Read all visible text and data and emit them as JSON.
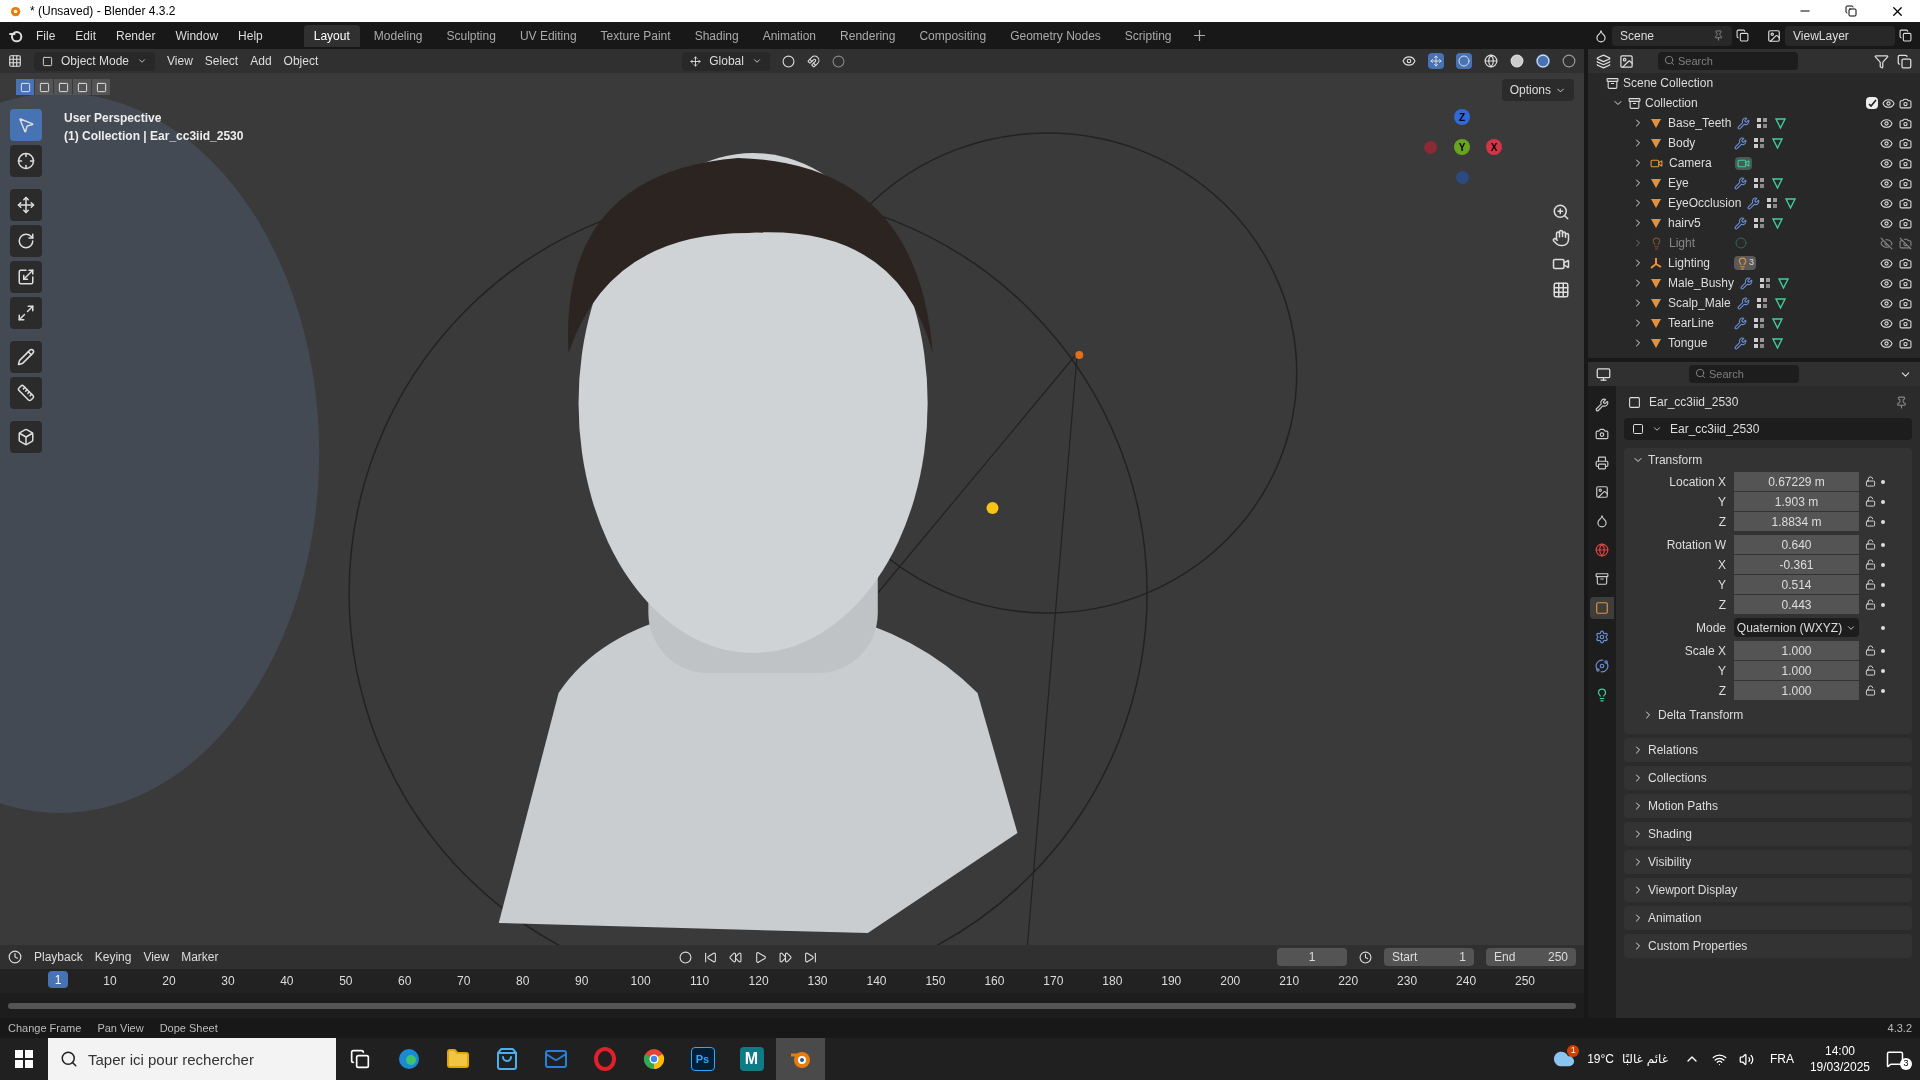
{
  "window": {
    "title": "* (Unsaved) - Blender 4.3.2"
  },
  "menu": [
    "File",
    "Edit",
    "Render",
    "Window",
    "Help"
  ],
  "workspaces": [
    {
      "label": "Layout",
      "selected": true
    },
    {
      "label": "Modeling",
      "selected": false
    },
    {
      "label": "Sculpting",
      "selected": false
    },
    {
      "label": "UV Editing",
      "selected": false
    },
    {
      "label": "Texture Paint",
      "selected": false
    },
    {
      "label": "Shading",
      "selected": false
    },
    {
      "label": "Animation",
      "selected": false
    },
    {
      "label": "Rendering",
      "selected": false
    },
    {
      "label": "Compositing",
      "selected": false
    },
    {
      "label": "Geometry Nodes",
      "selected": false
    },
    {
      "label": "Scripting",
      "selected": false
    }
  ],
  "scene": "Scene",
  "view_layer": "ViewLayer",
  "viewport_header": {
    "mode": "Object Mode",
    "menus": [
      "View",
      "Select",
      "Add",
      "Object"
    ],
    "orientation": "Global",
    "options": "Options"
  },
  "viewport": {
    "overlay": [
      "User Perspective",
      "(1) Collection | Ear_cc3iid_2530"
    ],
    "picture": {
      "kind": "picture"
    },
    "axes": [
      {
        "label": "Z",
        "color": "#2f6ad8"
      },
      {
        "label": "X",
        "color": "#d4334a"
      },
      {
        "label": "Y",
        "color": "#6aa31f"
      }
    ]
  },
  "outliner": {
    "search_placeholder": "Search",
    "root": "Scene Collection",
    "collection": {
      "name": "Collection",
      "expanded": true,
      "checked": true,
      "children": [
        {
          "name": "Base_Teeth",
          "kind": "mesh",
          "visible": true
        },
        {
          "name": "Body",
          "kind": "mesh",
          "visible": true
        },
        {
          "name": "Camera",
          "kind": "camera",
          "visible": true
        },
        {
          "name": "Eye",
          "kind": "mesh",
          "visible": true
        },
        {
          "name": "EyeOcclusion",
          "kind": "mesh",
          "visible": true
        },
        {
          "name": "hairv5",
          "kind": "mesh",
          "visible": true
        },
        {
          "name": "Light",
          "kind": "light",
          "visible": false
        },
        {
          "name": "Lighting",
          "kind": "empty",
          "visible": true,
          "badge": "3"
        },
        {
          "name": "Male_Bushy",
          "kind": "mesh",
          "visible": true
        },
        {
          "name": "Scalp_Male",
          "kind": "mesh",
          "visible": true
        },
        {
          "name": "TearLine",
          "kind": "mesh",
          "visible": true
        },
        {
          "name": "Tongue",
          "kind": "mesh",
          "visible": true
        }
      ]
    }
  },
  "properties": {
    "search_placeholder": "Search",
    "tabs": [
      {
        "kind": "tool",
        "selected": false
      },
      {
        "kind": "render",
        "selected": false
      },
      {
        "kind": "output",
        "selected": false
      },
      {
        "kind": "view_layer",
        "selected": false
      },
      {
        "kind": "scene",
        "selected": false
      },
      {
        "kind": "world",
        "selected": false
      },
      {
        "kind": "collection",
        "selected": false
      },
      {
        "kind": "object",
        "selected": true
      },
      {
        "kind": "modifiers",
        "selected": false
      },
      {
        "kind": "physics",
        "selected": false
      },
      {
        "kind": "data",
        "selected": false
      }
    ],
    "object_name": "Ear_cc3iid_2530",
    "data_name": "Ear_cc3iid_2530",
    "transform": {
      "title": "Transform",
      "expanded": true,
      "groups": [
        [
          {
            "label": "Location X",
            "value": "0.67229 m",
            "locked": false
          },
          {
            "label": "Y",
            "value": "1.903 m",
            "locked": false
          },
          {
            "label": "Z",
            "value": "1.8834 m",
            "locked": false
          }
        ],
        [
          {
            "label": "Rotation W",
            "value": "0.640",
            "locked": false
          },
          {
            "label": "X",
            "value": "-0.361",
            "locked": false
          },
          {
            "label": "Y",
            "value": "0.514",
            "locked": false
          },
          {
            "label": "Z",
            "value": "0.443",
            "locked": false
          }
        ],
        [
          {
            "label": "Mode",
            "value": "Quaternion (WXYZ)",
            "kind": "dropdown"
          }
        ],
        [
          {
            "label": "Scale X",
            "value": "1.000",
            "locked": false
          },
          {
            "label": "Y",
            "value": "1.000",
            "locked": false
          },
          {
            "label": "Z",
            "value": "1.000",
            "locked": false
          }
        ]
      ],
      "subpanel": {
        "title": "Delta Transform",
        "expanded": false
      }
    },
    "panels": [
      {
        "title": "Relations",
        "expanded": false
      },
      {
        "title": "Collections",
        "expanded": false
      },
      {
        "title": "Motion Paths",
        "expanded": false
      },
      {
        "title": "Shading",
        "expanded": false
      },
      {
        "title": "Visibility",
        "expanded": false
      },
      {
        "title": "Viewport Display",
        "expanded": false
      },
      {
        "title": "Animation",
        "expanded": false
      },
      {
        "title": "Custom Properties",
        "expanded": false
      }
    ]
  },
  "timeline": {
    "menus": [
      "Playback",
      "Keying",
      "View",
      "Marker"
    ],
    "current_frame": "1",
    "start_label": "Start",
    "start": "1",
    "end_label": "End",
    "end": "250",
    "marker": "1",
    "ticks": [
      "10",
      "20",
      "30",
      "40",
      "50",
      "60",
      "70",
      "80",
      "90",
      "100",
      "110",
      "120",
      "130",
      "140",
      "150",
      "160",
      "170",
      "180",
      "190",
      "200",
      "210",
      "220",
      "230",
      "240",
      "250"
    ]
  },
  "status_bar": {
    "hints": [
      "Change Frame",
      "Pan View",
      "Dope Sheet"
    ],
    "version": "4.3.2"
  },
  "taskbar": {
    "search_placeholder": "Taper ici pour rechercher",
    "apps": [
      {
        "kind": "edge",
        "selected": false
      },
      {
        "kind": "explorer",
        "selected": false
      },
      {
        "kind": "store",
        "selected": false
      },
      {
        "kind": "outlook",
        "selected": false
      },
      {
        "kind": "opera",
        "selected": false
      },
      {
        "kind": "chrome",
        "selected": false
      },
      {
        "kind": "photoshop",
        "label": "Ps",
        "selected": false
      },
      {
        "kind": "app",
        "label": "M",
        "selected": false
      },
      {
        "kind": "blender",
        "selected": true
      }
    ],
    "weather_badge": "1",
    "temperature": "19°C",
    "weather": "غائم غالبًا",
    "language": "FRA",
    "time": "14:00",
    "date": "19/03/2025",
    "notifications": "3"
  }
}
